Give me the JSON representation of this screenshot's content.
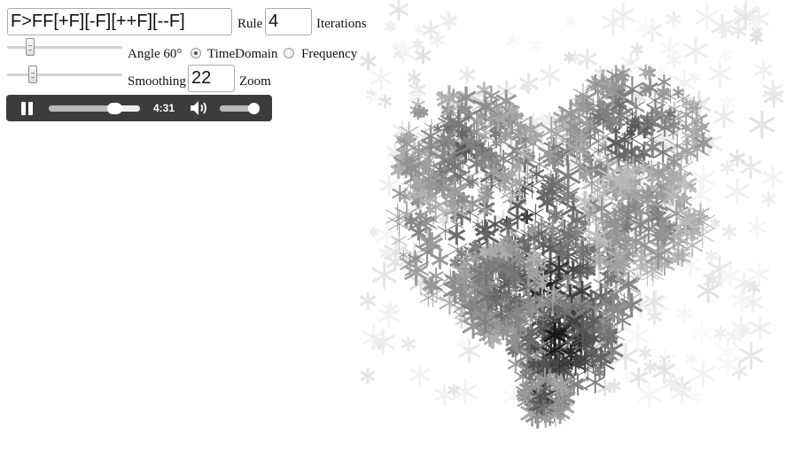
{
  "rule_input": {
    "value": "F>FF[+F][-F][++F][--F]"
  },
  "rule_label": "Rule",
  "iterations_input": {
    "value": "4"
  },
  "iterations_label": "Iterations",
  "angle_label": "Angle 60°",
  "angle_slider": {
    "level": 0.19
  },
  "mode": {
    "options": [
      {
        "label": "TimeDomain",
        "selected": true
      },
      {
        "label": "Frequency",
        "selected": false
      }
    ]
  },
  "smoothing_slider": {
    "level": 0.21
  },
  "smoothing_label": "Smoothing",
  "zoom_input": {
    "value": "22"
  },
  "zoom_label": "Zoom",
  "player": {
    "time": "4:31",
    "progress": 0.74,
    "volume": 0.85,
    "background": "#3c3c3c"
  }
}
